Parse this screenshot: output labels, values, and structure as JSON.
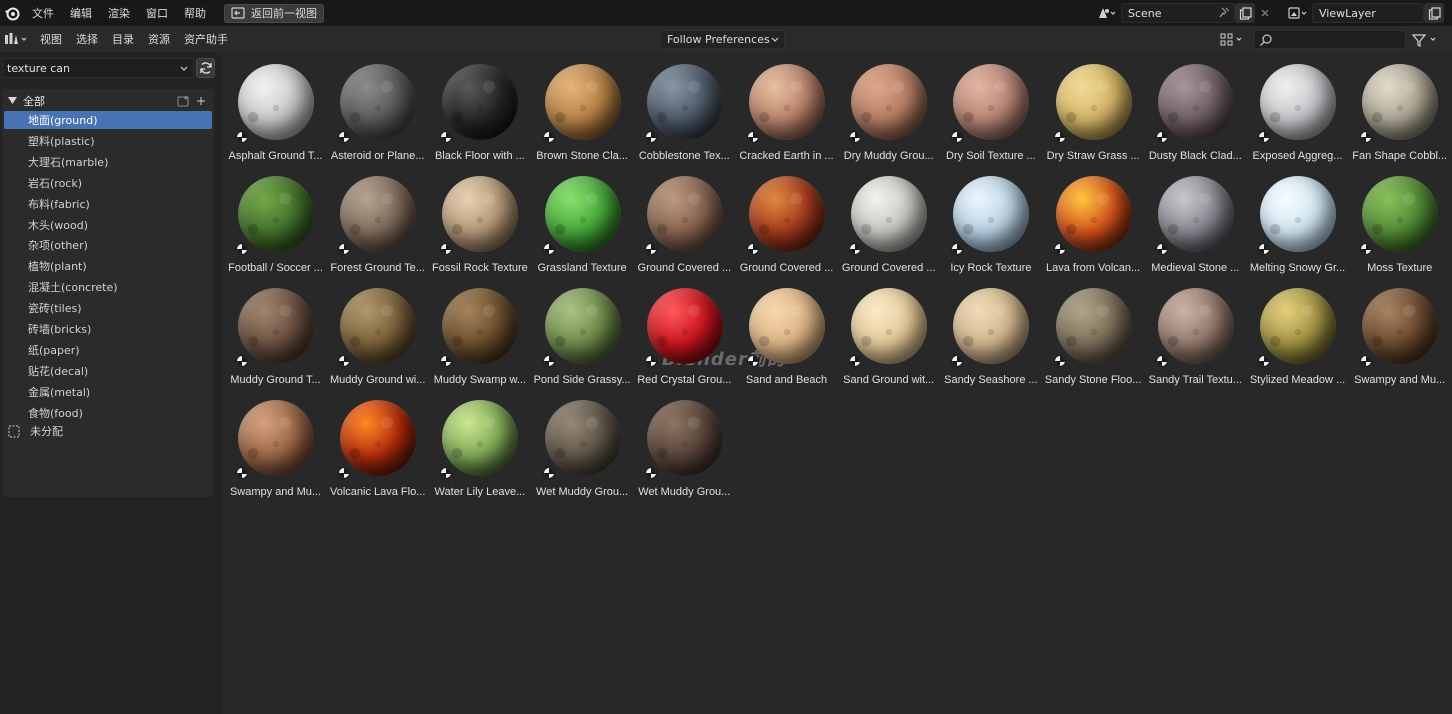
{
  "topbar": {
    "menus": [
      "文件",
      "编辑",
      "渲染",
      "窗口",
      "帮助"
    ],
    "back_button": "返回前一视图",
    "scene": "Scene",
    "view_layer": "ViewLayer"
  },
  "header": {
    "menus": [
      "视图",
      "选择",
      "目录",
      "资源",
      "资产助手"
    ],
    "import_method": "Follow Preferences",
    "search_placeholder": ""
  },
  "sidebar": {
    "library": "texture can",
    "root_label": "全部",
    "categories": [
      {
        "label": "地面(ground)",
        "selected": true
      },
      {
        "label": "塑料(plastic)"
      },
      {
        "label": "大理石(marble)"
      },
      {
        "label": "岩石(rock)"
      },
      {
        "label": "布料(fabric)"
      },
      {
        "label": "木头(wood)"
      },
      {
        "label": "杂项(other)"
      },
      {
        "label": "植物(plant)"
      },
      {
        "label": "混凝土(concrete)"
      },
      {
        "label": "瓷砖(tiles)"
      },
      {
        "label": "砖墙(bricks)"
      },
      {
        "label": "纸(paper)"
      },
      {
        "label": "贴花(decal)"
      },
      {
        "label": "金属(metal)"
      },
      {
        "label": "食物(food)"
      }
    ],
    "unassigned": "未分配"
  },
  "assets": [
    {
      "name": "Asphalt Ground T...",
      "colors": [
        "#f2f2f2",
        "#c8c8c8",
        "#8a8a8a"
      ]
    },
    {
      "name": "Asteroid or Plane...",
      "colors": [
        "#8c8c8c",
        "#5a5a5a",
        "#2e2e2e"
      ]
    },
    {
      "name": "Black Floor with ...",
      "colors": [
        "#5a5a5a",
        "#262626",
        "#0c0c0c"
      ]
    },
    {
      "name": "Brown Stone Cla...",
      "colors": [
        "#e6b47a",
        "#b68146",
        "#5a3c1e"
      ]
    },
    {
      "name": "Cobblestone Tex...",
      "colors": [
        "#8796a6",
        "#4c5866",
        "#1f2328"
      ]
    },
    {
      "name": "Cracked Earth in ...",
      "colors": [
        "#e8c0a0",
        "#b8826a",
        "#6a4232"
      ]
    },
    {
      "name": "Dry Muddy Grou...",
      "colors": [
        "#e0a88a",
        "#b27c62",
        "#5e3a2a"
      ]
    },
    {
      "name": "Dry Soil Texture ...",
      "colors": [
        "#e6b4a2",
        "#b68474",
        "#6c4840"
      ]
    },
    {
      "name": "Dry Straw Grass ...",
      "colors": [
        "#f2dc98",
        "#d4b466",
        "#7e6a34"
      ]
    },
    {
      "name": "Dusty Black Clad...",
      "colors": [
        "#a8949c",
        "#6e5e66",
        "#302a2e"
      ]
    },
    {
      "name": "Exposed Aggreg...",
      "colors": [
        "#f0f0f2",
        "#c4c4c8",
        "#7e7e84"
      ]
    },
    {
      "name": "Fan Shape Cobbl...",
      "colors": [
        "#e2dccc",
        "#aaa492",
        "#5e5a4e"
      ]
    },
    {
      "name": "Football / Soccer ...",
      "colors": [
        "#74a84a",
        "#43722a",
        "#1b3812"
      ]
    },
    {
      "name": "Forest Ground Te...",
      "colors": [
        "#b6a492",
        "#7e6a5a",
        "#3e3028"
      ]
    },
    {
      "name": "Fossil Rock Texture",
      "colors": [
        "#e8d0b2",
        "#b49878",
        "#6a5238"
      ]
    },
    {
      "name": "Grassland Texture",
      "colors": [
        "#8ae070",
        "#44a838",
        "#1a4a14"
      ]
    },
    {
      "name": "Ground Covered ...",
      "colors": [
        "#bc9a7e",
        "#876450",
        "#44302a"
      ]
    },
    {
      "name": "Ground Covered ...",
      "colors": [
        "#e08a40",
        "#a2381c",
        "#3e160c"
      ]
    },
    {
      "name": "Ground Covered ...",
      "colors": [
        "#f2f2ee",
        "#c6c4be",
        "#7e7c78"
      ]
    },
    {
      "name": "Icy Rock Texture",
      "colors": [
        "#eef6fc",
        "#b8d0e2",
        "#6a8aa6"
      ]
    },
    {
      "name": "Lava from Volcan...",
      "colors": [
        "#ffc840",
        "#d2501a",
        "#3a0e08"
      ]
    },
    {
      "name": "Medieval Stone ...",
      "colors": [
        "#c8c8cc",
        "#868690",
        "#38383e"
      ]
    },
    {
      "name": "Melting Snowy Gr...",
      "colors": [
        "#f6fcff",
        "#cfe4f0",
        "#88aac4"
      ]
    },
    {
      "name": "Moss Texture",
      "colors": [
        "#8ac05c",
        "#528a34",
        "#22441a"
      ]
    },
    {
      "name": "Muddy Ground T...",
      "colors": [
        "#a2866e",
        "#6a5040",
        "#2e2018"
      ]
    },
    {
      "name": "Muddy Ground wi...",
      "colors": [
        "#b2986c",
        "#7a6038",
        "#342614"
      ]
    },
    {
      "name": "Muddy Swamp w...",
      "colors": [
        "#a6845c",
        "#6a4e2c",
        "#2a1c10"
      ]
    },
    {
      "name": "Pond Side Grassy...",
      "colors": [
        "#aac486",
        "#6e8a4a",
        "#2e401e"
      ]
    },
    {
      "name": "Red Crystal Grou...",
      "colors": [
        "#ff5a5a",
        "#c8141e",
        "#4a0408"
      ]
    },
    {
      "name": "Sand and Beach",
      "colors": [
        "#f6d8ae",
        "#dcb484",
        "#9a7854"
      ]
    },
    {
      "name": "Sand Ground wit...",
      "colors": [
        "#faeac8",
        "#e2c898",
        "#a48c62"
      ]
    },
    {
      "name": "Sandy Seashore ...",
      "colors": [
        "#f0dab8",
        "#d2b68e",
        "#907658"
      ]
    },
    {
      "name": "Sandy Stone Floo...",
      "colors": [
        "#b2a68a",
        "#7a6e58",
        "#3a3428"
      ]
    },
    {
      "name": "Sandy Trail Textu...",
      "colors": [
        "#cab4a4",
        "#92786c",
        "#4a3c36"
      ]
    },
    {
      "name": "Stylized Meadow ...",
      "colors": [
        "#e6ce7e",
        "#a09240",
        "#3e3e1c"
      ]
    },
    {
      "name": "Swampy and Mu...",
      "colors": [
        "#a88462",
        "#6a4a2e",
        "#2a1a10"
      ]
    },
    {
      "name": "Swampy and Mu...",
      "colors": [
        "#d6a27e",
        "#9a6646",
        "#4a2a1a"
      ]
    },
    {
      "name": "Volcanic Lava Flo...",
      "colors": [
        "#ff8a26",
        "#b42a0a",
        "#2a0c06"
      ]
    },
    {
      "name": "Water Lily Leave...",
      "colors": [
        "#cce890",
        "#7ea856",
        "#24361a"
      ]
    },
    {
      "name": "Wet Muddy Grou...",
      "colors": [
        "#968a78",
        "#5e5446",
        "#282420"
      ]
    },
    {
      "name": "Wet Muddy Grou...",
      "colors": [
        "#8e7462",
        "#58443a",
        "#241a16"
      ]
    }
  ],
  "watermark": "Blender前的"
}
